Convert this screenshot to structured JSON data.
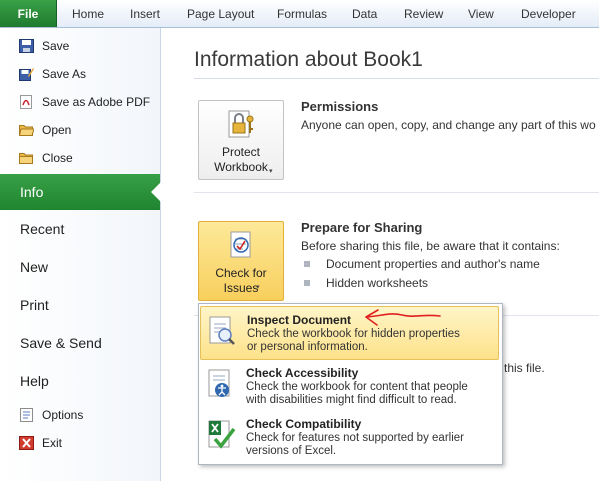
{
  "ribbon": {
    "tabs": [
      "File",
      "Home",
      "Insert",
      "Page Layout",
      "Formulas",
      "Data",
      "Review",
      "View",
      "Developer"
    ]
  },
  "nav": {
    "commands": [
      {
        "label": "Save",
        "icon": "floppy-disk-icon"
      },
      {
        "label": "Save As",
        "icon": "save-as-icon"
      },
      {
        "label": "Save as Adobe PDF",
        "icon": "pdf-icon"
      },
      {
        "label": "Open",
        "icon": "open-folder-icon"
      },
      {
        "label": "Close",
        "icon": "close-folder-icon"
      }
    ],
    "sections": [
      "Info",
      "Recent",
      "New",
      "Print",
      "Save & Send",
      "Help"
    ],
    "active": "Info",
    "footer": [
      {
        "label": "Options",
        "icon": "options-icon"
      },
      {
        "label": "Exit",
        "icon": "exit-icon"
      }
    ]
  },
  "main": {
    "title": "Information about Book1",
    "permissions": {
      "button_line1": "Protect",
      "button_line2": "Workbook",
      "heading": "Permissions",
      "text": "Anyone can open, copy, and change any part of this wo"
    },
    "sharing": {
      "button_line1": "Check for",
      "button_line2": "Issues",
      "heading": "Prepare for Sharing",
      "text": "Before sharing this file, be aware that it contains:",
      "items": [
        "Document properties and author's name",
        "Hidden worksheets"
      ]
    },
    "partial_text": "this file."
  },
  "menu": {
    "items": [
      {
        "title": "Inspect Document",
        "desc1": "Check the workbook for hidden properties",
        "desc2": "or personal information.",
        "highlighted": true
      },
      {
        "title": "Check Accessibility",
        "desc1": "Check the workbook for content that people",
        "desc2": "with disabilities might find difficult to read.",
        "highlighted": false
      },
      {
        "title": "Check Compatibility",
        "desc1": "Check for features not supported by earlier",
        "desc2": "versions of Excel.",
        "highlighted": false
      }
    ]
  },
  "colors": {
    "accent": "#2e8b3c",
    "highlight": "#fde28a",
    "annotation": "#e02020"
  }
}
